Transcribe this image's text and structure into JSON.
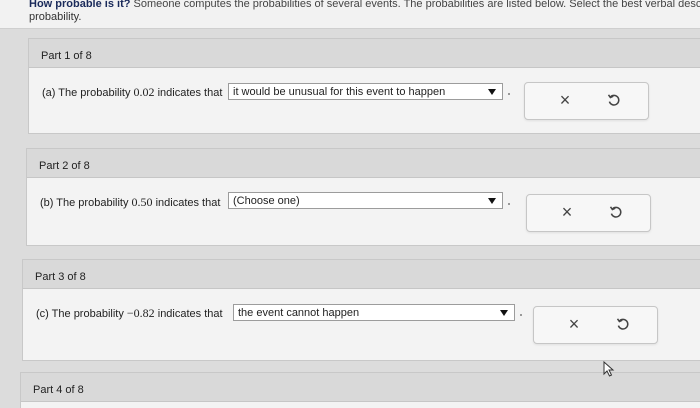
{
  "header": {
    "bold_text": "How probable is it?",
    "instruction": "Someone computes the probabilities of several events. The probabilities are listed below. Select the best verbal descri",
    "instruction_cont": "probability."
  },
  "parts": [
    {
      "part_label": "Part 1 of 8",
      "prompt_prefix": "(a) The probability",
      "value": "0.02",
      "prompt_suffix": "indicates that",
      "selected": "it would be unusual for this event to happen"
    },
    {
      "part_label": "Part 2 of 8",
      "prompt_prefix": "(b) The probability",
      "value": "0.50",
      "prompt_suffix": "indicates that",
      "selected": "(Choose one)"
    },
    {
      "part_label": "Part 3 of 8",
      "prompt_prefix": "(c) The probability",
      "value": "−0.82",
      "prompt_suffix": "indicates that",
      "selected": "the event cannot happen"
    },
    {
      "part_label": "Part 4 of 8"
    }
  ],
  "icons": {
    "clear": "close-icon",
    "reset": "redo-icon"
  },
  "glyphs": {
    "x": "×"
  }
}
